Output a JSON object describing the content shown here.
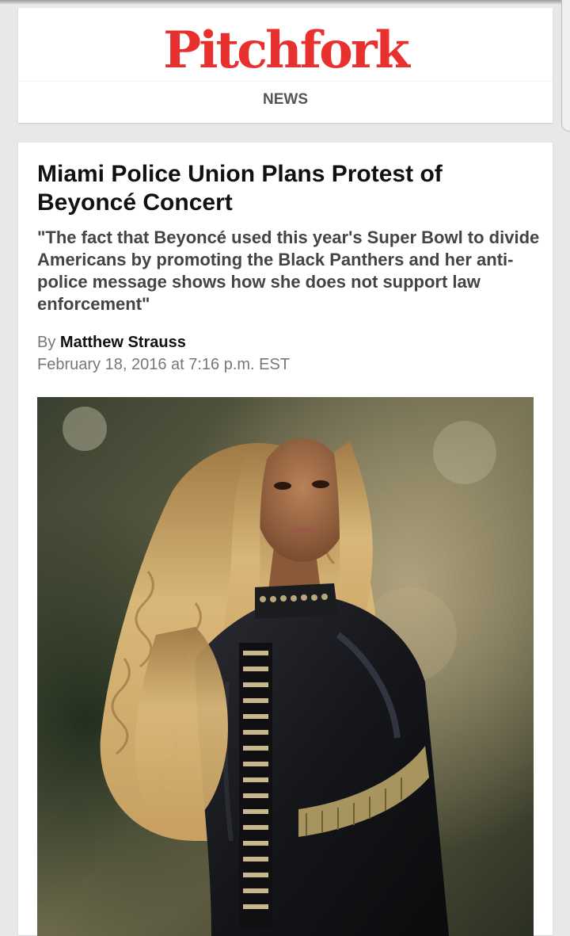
{
  "site": {
    "logo_text": "Pitchfork",
    "section_label": "NEWS"
  },
  "article": {
    "headline": "Miami Police Union Plans Protest of Beyoncé Concert",
    "dek": "\"The fact that Beyoncé used this year's Super Bowl to divide Americans by promoting the Black Panthers and her anti-police message shows how she does not support law enforcement\"",
    "byline_prefix": "By",
    "author": "Matthew Strauss",
    "date": "February 18, 2016 at 7:16 p.m. EST",
    "image": {
      "alt": "Beyoncé performing in a black leather jacket with gold bullet-belt details"
    }
  },
  "colors": {
    "brand_red": "#e8312f",
    "page_bg": "#e8e8e8",
    "card_bg": "#ffffff",
    "headline": "#111111",
    "dek": "#444444",
    "meta": "#777777"
  }
}
